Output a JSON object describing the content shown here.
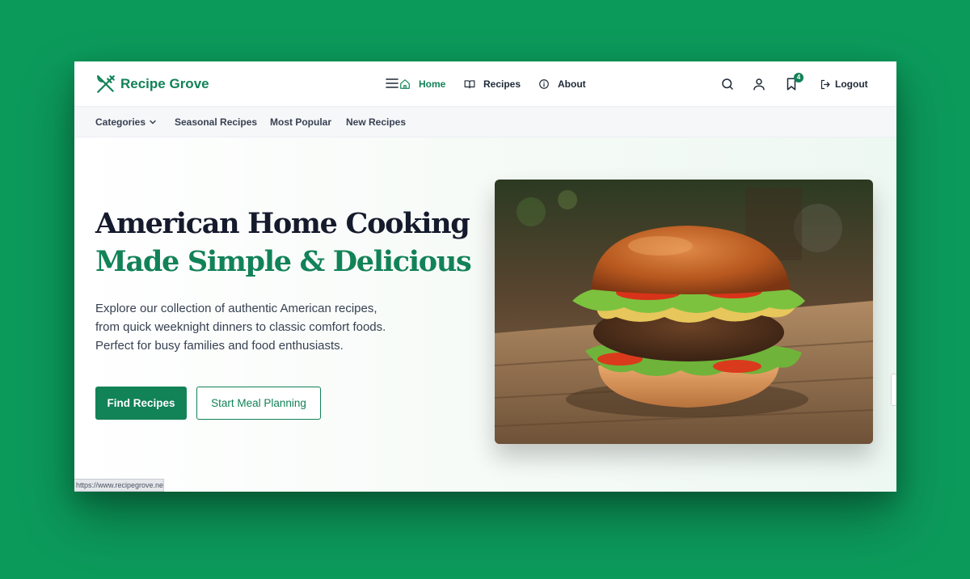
{
  "brand": {
    "name": "Recipe Grove",
    "icon": "fork-knife-icon",
    "color": "#128257"
  },
  "nav": {
    "items": [
      {
        "label": "Home",
        "icon": "home-icon",
        "active": true
      },
      {
        "label": "Recipes",
        "icon": "book-icon",
        "active": false
      },
      {
        "label": "About",
        "icon": "info-icon",
        "active": false
      }
    ],
    "bookmark_count": "4",
    "logout_label": "Logout"
  },
  "subnav": {
    "categories_label": "Categories",
    "items": [
      "Seasonal Recipes",
      "Most Popular",
      "New Recipes"
    ]
  },
  "hero": {
    "headline_line1": "American Home Cooking",
    "headline_line2": "Made Simple & Delicious",
    "description": "Explore our collection of authentic American recipes, from quick weeknight dinners to classic comfort foods. Perfect for busy families and food enthusiasts.",
    "primary_button": "Find Recipes",
    "secondary_button": "Start Meal Planning",
    "image_subject": "burger"
  },
  "status_bar": {
    "url": "https://www.recipegrove.net"
  },
  "colors": {
    "page_background": "#0c9a5b",
    "accent": "#128257",
    "heading": "#151a2c"
  }
}
